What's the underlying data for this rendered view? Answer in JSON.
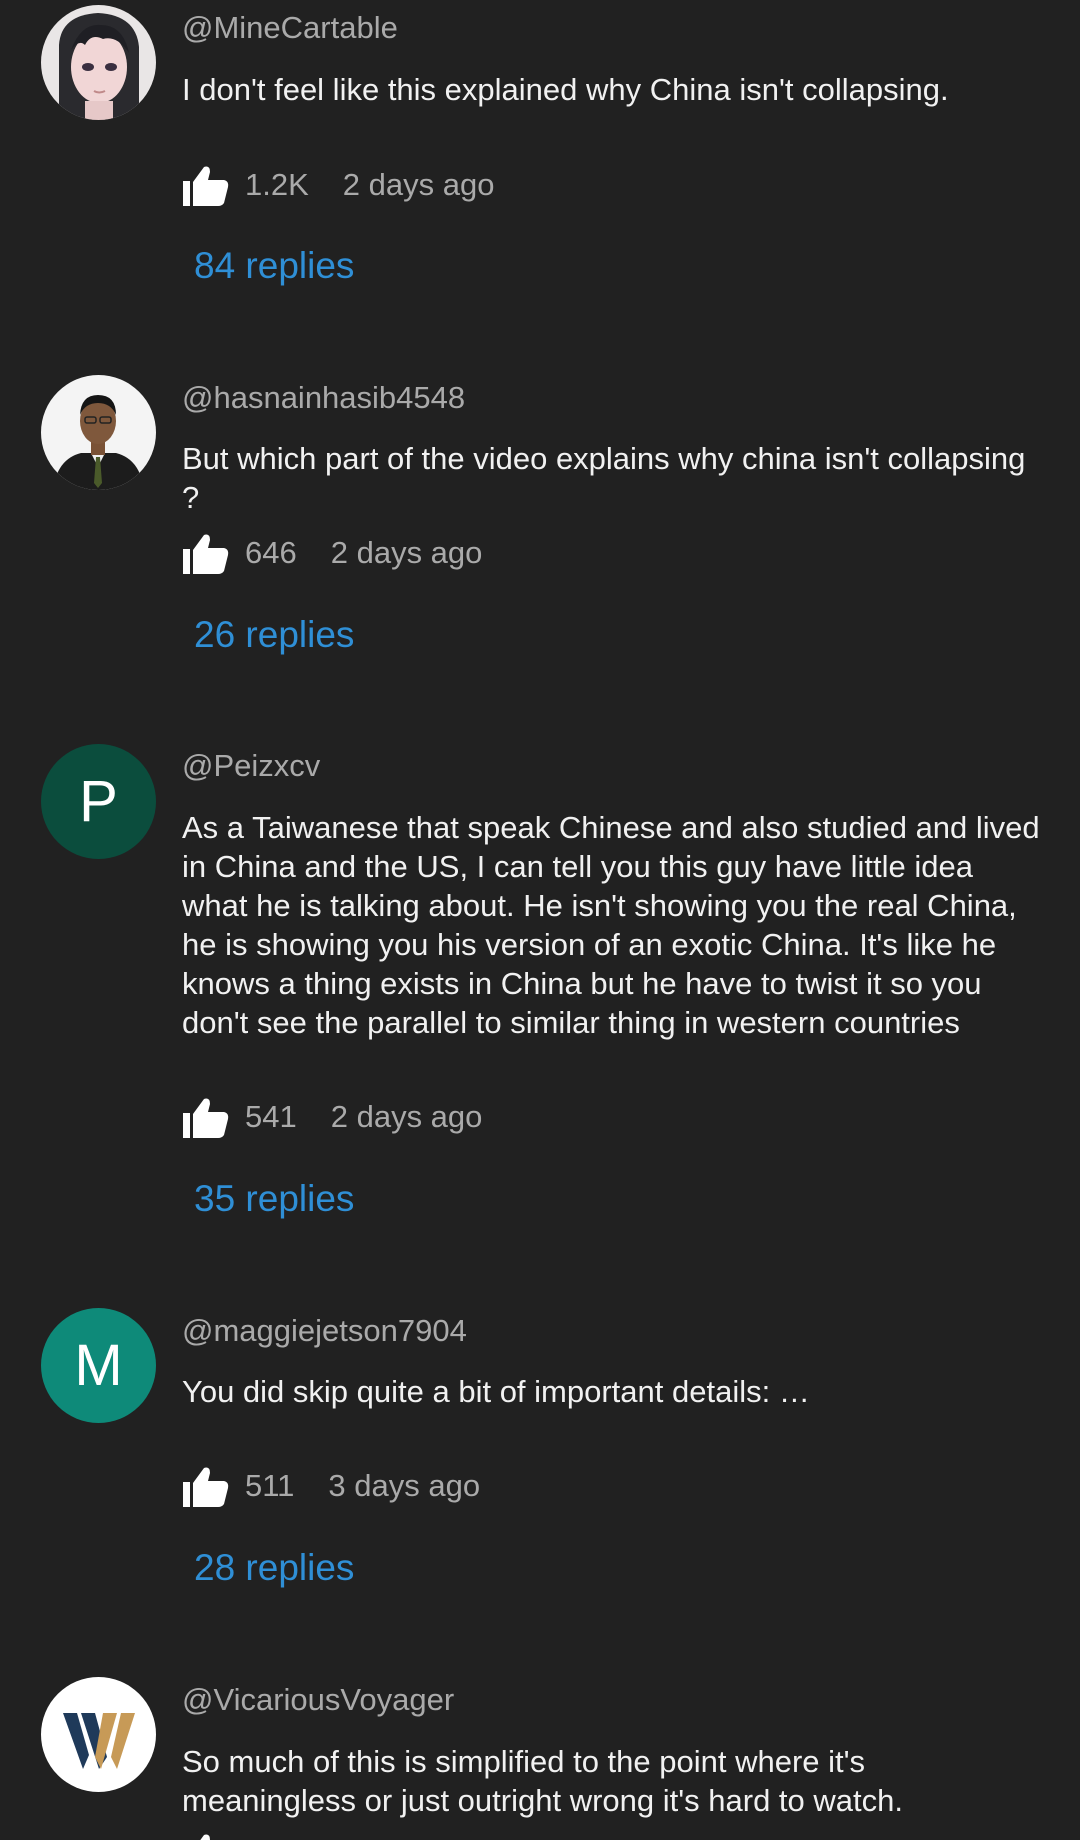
{
  "comments": [
    {
      "author": "@MineCartable",
      "text": "I don't feel like this explained why China isn't collapsing.",
      "likes": "1.2K",
      "time": "2 days ago",
      "replies": "84 replies",
      "avatar": "anime-character-avatar"
    },
    {
      "author": "@hasnainhasib4548",
      "text": "But which part of the video explains why china isn't collapsing ?",
      "likes": "646",
      "time": "2 days ago",
      "replies": "26 replies",
      "avatar": "man-in-suit-photo-avatar"
    },
    {
      "author": "@Peizxcv",
      "text": "As a Taiwanese that speak Chinese and also studied and lived in China and the US, I can tell you this guy have little idea what he is talking about. He isn't showing you the real China, he is showing you his version of an exotic China. It's like he knows a thing exists in China but he have to twist it so you don't see the parallel to similar thing in western countries",
      "likes": "541",
      "time": "2 days ago",
      "replies": "35 replies",
      "avatar_letter": "P",
      "avatar_color": "#0b4d3d"
    },
    {
      "author": "@maggiejetson7904",
      "text": "You did skip quite a bit of important details: …",
      "likes": "511",
      "time": "3 days ago",
      "replies": "28 replies",
      "avatar_letter": "M",
      "avatar_color": "#0e8a79"
    },
    {
      "author": "@VicariousVoyager",
      "text": "So much of this is simplified to the point where it's meaningless or just outright wrong it's hard to watch.",
      "avatar": "w-logo-avatar"
    }
  ],
  "colors": {
    "background": "#212121",
    "author": "#aaaaaa",
    "body_text": "#f1f1f1",
    "replies_link": "#2f8fd6"
  },
  "icons": {
    "like": "thumbs-up-icon"
  }
}
